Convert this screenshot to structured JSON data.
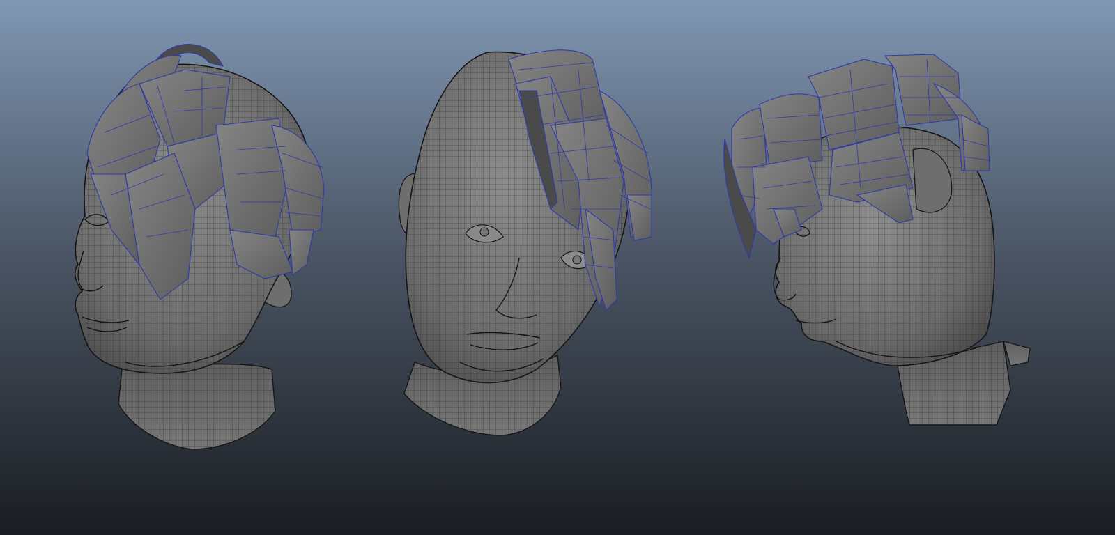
{
  "scene": {
    "description_free": true,
    "background_top": "#8097b3",
    "background_bottom": "#1a1d22",
    "mesh_color": "#777777",
    "wire_color": "#1c1c1c",
    "hair_edge_color": "#2e3aa8"
  },
  "models": [
    {
      "view": "three-quarter-left"
    },
    {
      "view": "front"
    },
    {
      "view": "side-right"
    }
  ]
}
